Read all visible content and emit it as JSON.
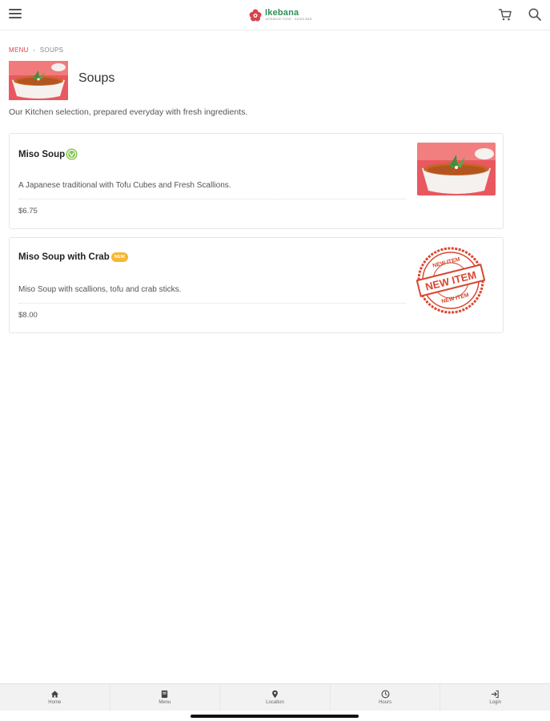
{
  "header": {
    "logo": {
      "name": "Ikebana",
      "tagline": "JAPANESE FOOD · SUSHI BAR"
    },
    "icons": {
      "menu": "hamburger-icon",
      "cart": "cart-icon",
      "search": "search-icon"
    }
  },
  "breadcrumb": {
    "parent": "MENU",
    "separator": "›",
    "current": "SOUPS"
  },
  "category": {
    "title": "Soups",
    "description": "Our Kitchen selection, prepared everyday with fresh ingredients."
  },
  "items": [
    {
      "name": "Miso Soup",
      "badge": "vegetarian-badge-icon",
      "description": "A Japanese traditional with Tofu Cubes and Fresh Scallions.",
      "price": "$6.75"
    },
    {
      "name": "Miso Soup with Crab",
      "badge_label": "NEW",
      "description": "Miso Soup with scallions, tofu and crab sticks.",
      "price": "$8.00",
      "stamp_text": "NEW ITEM"
    }
  ],
  "tabs": [
    {
      "label": "Home",
      "icon": "home-icon"
    },
    {
      "label": "Menu",
      "icon": "book-icon"
    },
    {
      "label": "Location",
      "icon": "location-pin-icon"
    },
    {
      "label": "Hours",
      "icon": "clock-icon"
    },
    {
      "label": "Login",
      "icon": "login-icon"
    }
  ],
  "colors": {
    "accent_red": "#d8434d",
    "brand_green": "#2f8f57",
    "new_badge": "#f7b731",
    "veg_badge": "#7cc243"
  }
}
